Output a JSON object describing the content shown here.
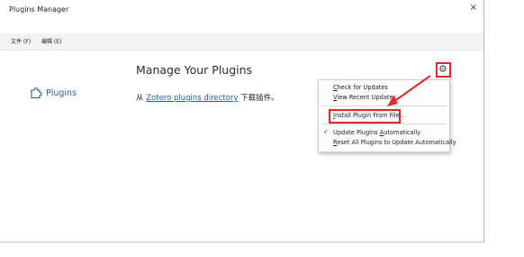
{
  "window": {
    "title": "Plugins Manager",
    "close_glyph": "×"
  },
  "menubar": {
    "items": [
      {
        "label": "文件 (F)"
      },
      {
        "label": "编辑 (E)"
      }
    ]
  },
  "sidebar": {
    "items": [
      {
        "icon": "puzzle-icon",
        "label": "Plugins"
      }
    ]
  },
  "main": {
    "title": "Manage Your Plugins",
    "from_prefix": "从",
    "link_text": "Zotero plugins directory",
    "from_suffix": "下载插件。",
    "gear_icon": "gear-icon"
  },
  "menu": {
    "items": [
      {
        "underline": "C",
        "rest": "heck for Updates"
      },
      {
        "underline": "V",
        "rest": "iew Recent Updates"
      },
      {
        "underline": "I",
        "rest": "nstall Plugin From File..."
      },
      {
        "prefix": "Update Plugins ",
        "underline": "A",
        "rest": "utomatically",
        "checked": true
      },
      {
        "underline": "R",
        "rest": "eset All Plugins to Update Automatically"
      }
    ]
  },
  "colors": {
    "highlight": "#e02a2a",
    "link": "#1f5fa8",
    "sidebar_text": "#2f5d8a"
  }
}
